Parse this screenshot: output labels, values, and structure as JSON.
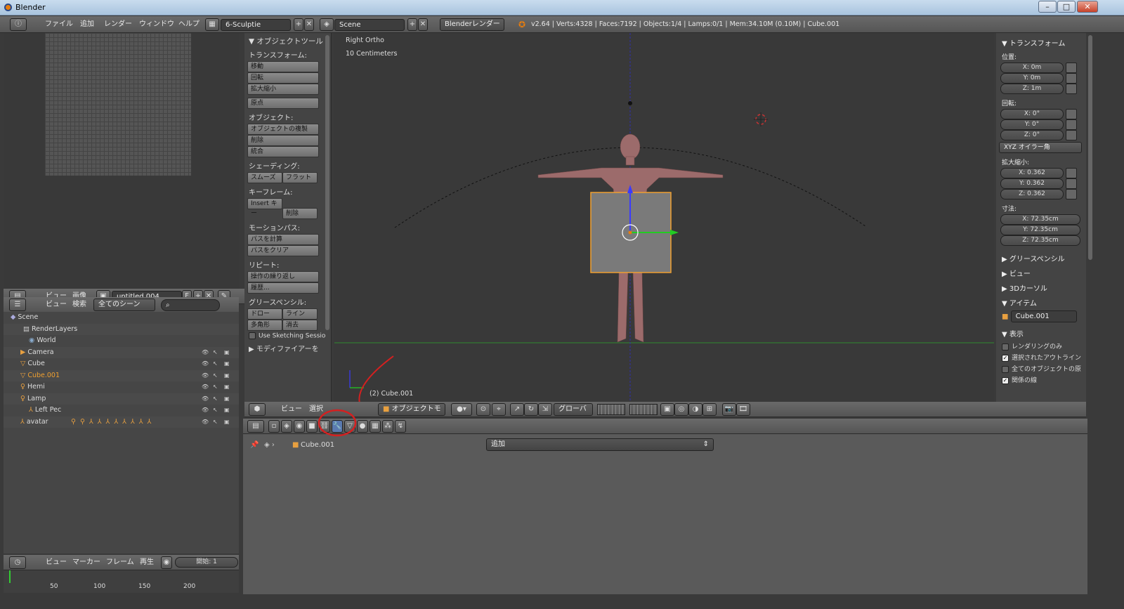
{
  "window": {
    "title": "Blender"
  },
  "topbar": {
    "menus": [
      "ファイル",
      "追加",
      "レンダー",
      "ウィンドウ",
      "ヘルプ"
    ],
    "screen": "6-Sculptie",
    "scene": "Scene",
    "engine": "Blenderレンダー",
    "stats": "v2.64 | Verts:4328 | Faces:7192 | Objects:1/4 | Lamps:0/1 | Mem:34.10M (0.10M) | Cube.001"
  },
  "image_editor": {
    "menus": [
      "ビュー",
      "画像"
    ],
    "image_name": "untitled.004",
    "f_label": "F"
  },
  "outliner": {
    "menus": [
      "ビュー",
      "検索"
    ],
    "filter": "全てのシーン",
    "items": [
      {
        "label": "Scene"
      },
      {
        "label": "RenderLayers"
      },
      {
        "label": "World"
      },
      {
        "label": "Camera"
      },
      {
        "label": "Cube"
      },
      {
        "label": "Cube.001"
      },
      {
        "label": "Hemi"
      },
      {
        "label": "Lamp"
      },
      {
        "label": "Left Pec"
      },
      {
        "label": "avatar"
      }
    ]
  },
  "timeline": {
    "menus": [
      "ビュー",
      "マーカー",
      "フレーム",
      "再生"
    ],
    "start": "開始: 1",
    "ticks": [
      "50",
      "100",
      "150",
      "200"
    ]
  },
  "tools": {
    "title": "オブジェクトツール",
    "transform_h": "トランスフォーム:",
    "move": "移動",
    "rotate": "回転",
    "scale": "拡大縮小",
    "origin": "原点",
    "object_h": "オブジェクト:",
    "duplicate": "オブジェクトの複製",
    "delete": "削除",
    "join": "統合",
    "shading_h": "シェーディング:",
    "smooth": "スムーズ",
    "flat": "フラット",
    "keyframe_h": "キーフレーム:",
    "insert_key": "Insert キー",
    "delete_key": "削除",
    "motion_h": "モーションパス:",
    "calc_path": "パスを計算",
    "clear_path": "パスをクリア",
    "repeat_h": "リピート:",
    "repeat_last": "操作の繰り返し",
    "history": "履歴...",
    "grease_h": "グリースペンシル:",
    "draw": "ドロー",
    "line": "ライン",
    "poly": "多角形",
    "erase": "消去",
    "sketching": "Use Sketching Sessio",
    "modifier": "モディファイアーを"
  },
  "viewport": {
    "view_name": "Right Ortho",
    "scale": "10 Centimeters",
    "object_label": "(2) Cube.001"
  },
  "vp_header": {
    "menus": [
      "ビュー",
      "選択"
    ],
    "mode": "オブジェクトモ",
    "orientation": "グローバ"
  },
  "npanel": {
    "transform_title": "トランスフォーム",
    "location_h": "位置:",
    "loc_x": "X: 0m",
    "loc_y": "Y: 0m",
    "loc_z": "Z: 1m",
    "rotation_h": "回転:",
    "rot_x": "X: 0°",
    "rot_y": "Y: 0°",
    "rot_z": "Z: 0°",
    "rot_mode": "XYZ オイラー角",
    "scale_h": "拡大縮小:",
    "sc_x": "X: 0.362",
    "sc_y": "Y: 0.362",
    "sc_z": "Z: 0.362",
    "dim_h": "寸法:",
    "dim_x": "X: 72.35cm",
    "dim_y": "Y: 72.35cm",
    "dim_z": "Z: 72.35cm",
    "grease": "グリースペンシル",
    "view": "ビュー",
    "cursor": "3Dカーソル",
    "item": "アイテム",
    "item_name": "Cube.001",
    "display": "表示",
    "render_only": "レンダリングのみ",
    "outline": "選択されたアウトライン",
    "all_origins": "全てのオブジェクトの原",
    "relations": "関係の線"
  },
  "properties": {
    "object": "Cube.001",
    "add_modifier": "追加"
  },
  "colors": {
    "accent": "#e87d0d",
    "annotation": "#d42020",
    "axis_y": "#22cc22",
    "axis_z": "#3a3aff"
  }
}
